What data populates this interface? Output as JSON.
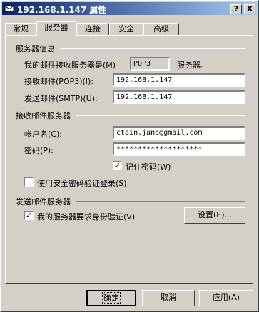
{
  "window": {
    "title": "192.168.1.147 属性",
    "help_label": "?",
    "close_label": "X"
  },
  "tabs": [
    {
      "label": "常规"
    },
    {
      "label": "服务器"
    },
    {
      "label": "连接"
    },
    {
      "label": "安全"
    },
    {
      "label": "高级"
    }
  ],
  "server_info": {
    "heading": "服务器信息",
    "incoming_type_label": "我的邮件接收服务器是(M)",
    "incoming_type_value": "POP3",
    "incoming_type_suffix": "服务器。",
    "pop3_label": "接收邮件(POP3)(I):",
    "pop3_value": "192.168.1.147",
    "smtp_label": "发送邮件(SMTP)(U):",
    "smtp_value": "192.168.1.147"
  },
  "incoming": {
    "heading": "接收邮件服务器",
    "account_label": "帐户名(C):",
    "account_value": "ctain.jane@gmail.com",
    "password_label": "密码(P):",
    "password_value": "********************",
    "remember_label": "记住密码(W)",
    "remember_checked": true,
    "spa_label": "使用安全密码验证登录(S)",
    "spa_checked": false
  },
  "outgoing": {
    "heading": "发送邮件服务器",
    "auth_label": "我的服务器要求身份验证(V)",
    "auth_checked": true,
    "settings_button": "设置(E)..."
  },
  "buttons": {
    "ok": "确定",
    "cancel": "取消",
    "apply": "应用(A)"
  }
}
